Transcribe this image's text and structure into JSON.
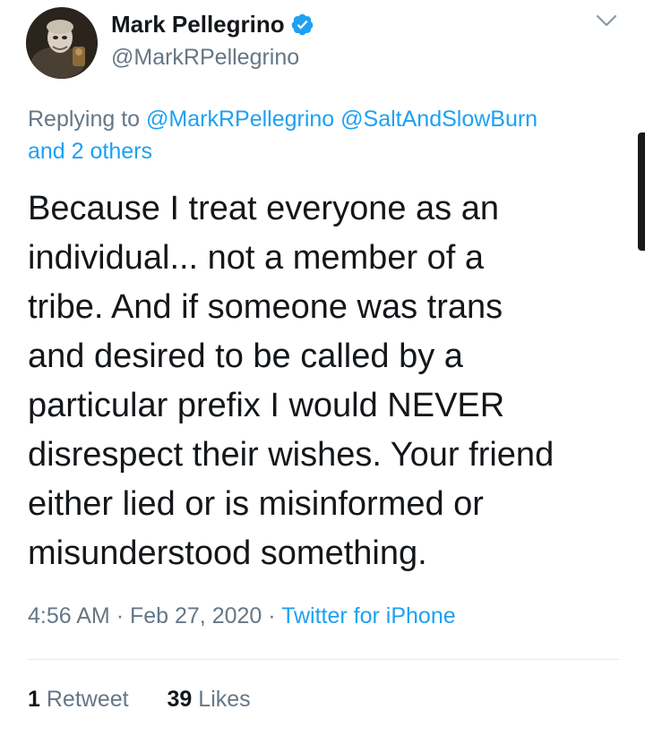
{
  "author": {
    "display_name": "Mark Pellegrino",
    "handle": "@MarkRPellegrino",
    "verified_icon": "verified-badge-icon",
    "avatar_icon": "avatar"
  },
  "reply": {
    "prefix": "Replying to",
    "mention_1": "@MarkRPellegrino",
    "mention_2": "@SaltAndSlowBurn",
    "others": "and 2 others"
  },
  "tweet": {
    "lines": [
      "Because I treat everyone as an",
      "individual... not a member of a",
      "tribe. And if someone was trans",
      "and desired to be called by a",
      "particular prefix I would NEVER",
      "disrespect their wishes. Your friend",
      "either lied or is misinformed or",
      "misunderstood something."
    ]
  },
  "meta": {
    "time": "4:56 AM",
    "date": "Feb 27, 2020",
    "separator": "·",
    "source": "Twitter for iPhone"
  },
  "stats": {
    "retweets_count": "1",
    "retweets_label": "Retweet",
    "likes_count": "39",
    "likes_label": "Likes"
  },
  "colors": {
    "link": "#1da1f2",
    "secondary_text": "#657786",
    "primary_text": "#14171a",
    "divider": "#e1e8ed"
  }
}
